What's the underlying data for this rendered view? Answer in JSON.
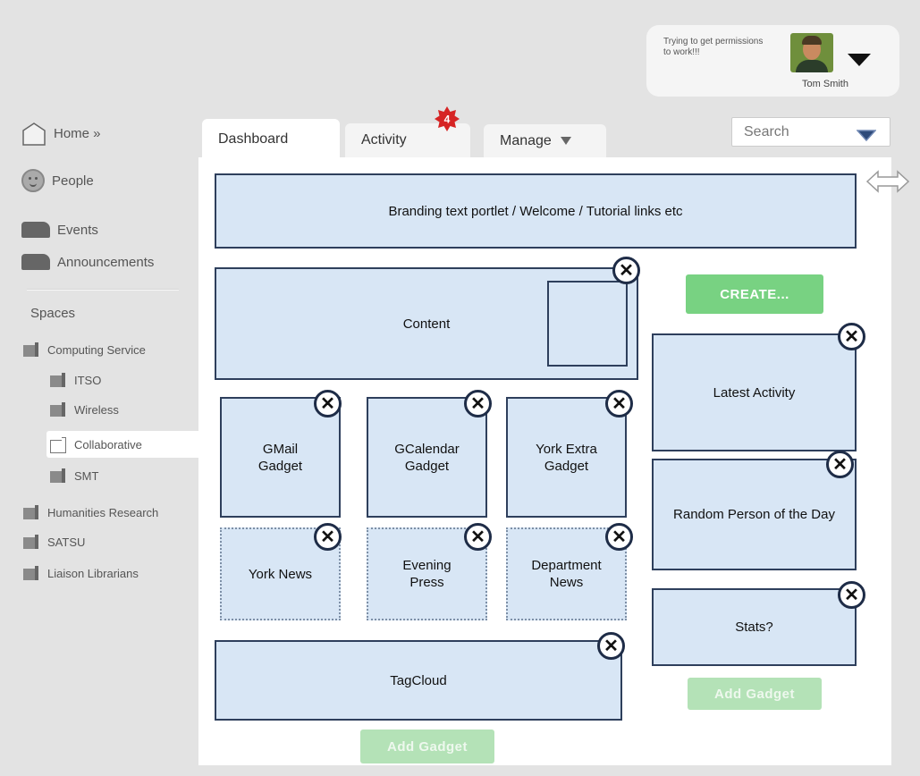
{
  "user": {
    "status": "Trying to get permissions to work!!!",
    "name": "Tom Smith"
  },
  "nav": {
    "home": "Home »",
    "people": "People",
    "events": "Events",
    "announcements": "Announcements"
  },
  "spaces": {
    "heading": "Spaces",
    "items": [
      {
        "label": "Computing Service"
      },
      {
        "label": "ITSO"
      },
      {
        "label": "Wireless"
      },
      {
        "label": "Collaborative"
      },
      {
        "label": "SMT"
      },
      {
        "label": "Humanities Research"
      },
      {
        "label": "SATSU"
      },
      {
        "label": "Liaison Librarians"
      }
    ]
  },
  "tabs": {
    "dashboard": "Dashboard",
    "activity": "Activity",
    "activity_badge": "4",
    "manage": "Manage"
  },
  "search": {
    "placeholder": "Search"
  },
  "colors": {
    "portlet_fill": "#d8e6f5",
    "portlet_border": "#2e3f5c",
    "create_button": "#78d282",
    "badge": "#d62424"
  },
  "portlets": {
    "branding": "Branding text portlet / Welcome / Tutorial links etc",
    "content": "Content",
    "gmail": "GMail Gadget",
    "gcalendar": "GCalendar Gadget",
    "york_extra": "York Extra Gadget",
    "york_news": "York News",
    "evening_press": "Evening Press",
    "department_news": "Department News",
    "tagcloud": "TagCloud",
    "latest_activity": "Latest Activity",
    "random_person": "Random Person of the Day",
    "stats": "Stats?"
  },
  "buttons": {
    "create": "CREATE...",
    "add_gadget": "Add Gadget",
    "close_symbol": "✕"
  }
}
